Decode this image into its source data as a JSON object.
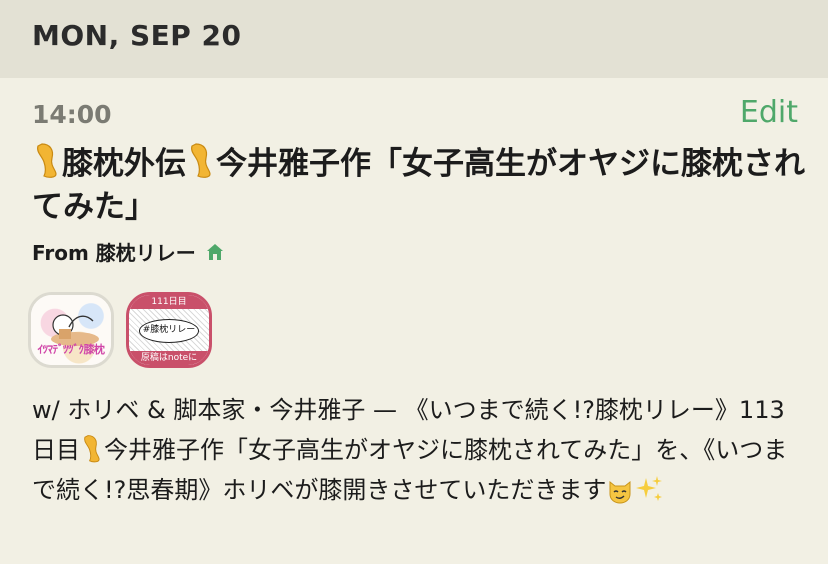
{
  "header": {
    "date": "MON, SEP 20"
  },
  "event": {
    "time": "14:00",
    "edit_label": "Edit",
    "title_part1": "膝枕外伝",
    "title_part2": "今井雅子作「女子高生がオヤジに膝枕されてみた」",
    "from_label": "From 膝枕リレー",
    "description_part1": "w/ ホリベ & 脚本家・今井雅子 — 《いつまで続く!?膝枕リレー》113日目",
    "description_part2": "今井雅子作「女子高生がオヤジに膝枕されてみた」を、《いつまで続く!?思春期》ホリベが膝開きさせていただきます"
  },
  "avatars": {
    "first_label": "ｲﾂﾏﾃﾞﾂﾂﾞｸ膝枕",
    "second_top": "111日目",
    "second_bubble": "#膝枕リレー",
    "second_bottom": "原稿はnoteに"
  },
  "colors": {
    "accent_green": "#4fa86a",
    "header_bg": "#e3e1d4",
    "page_bg": "#f2f0e4",
    "badge_pink": "#c9506a"
  },
  "icons": [
    "leg-emoji-icon",
    "home-icon",
    "cat-emoji-icon",
    "sparkles-emoji-icon"
  ]
}
